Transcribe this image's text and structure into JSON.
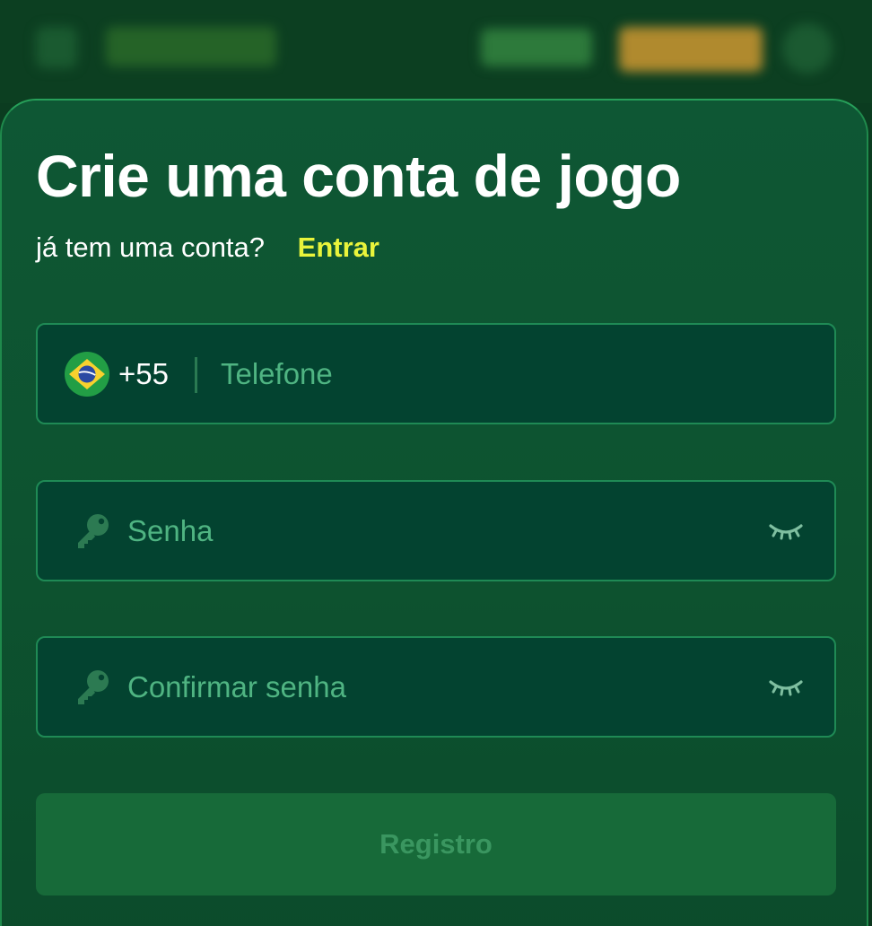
{
  "form": {
    "title": "Crie uma conta de jogo",
    "have_account_text": "já tem uma conta?",
    "login_link": "Entrar",
    "phone": {
      "country_flag": "brazil-flag-icon",
      "country_code": "+55",
      "placeholder": "Telefone",
      "value": ""
    },
    "password": {
      "icon": "key-icon",
      "placeholder": "Senha",
      "value": "",
      "toggle_icon": "eye-closed-icon"
    },
    "confirm_password": {
      "icon": "key-icon",
      "placeholder": "Confirmar senha",
      "value": "",
      "toggle_icon": "eye-closed-icon"
    },
    "submit_label": "Registro"
  },
  "colors": {
    "accent_link": "#e9f43b",
    "field_border": "#1f8a55",
    "field_bg": "#034330",
    "button_bg": "#176a39",
    "button_text": "#3a9660"
  }
}
